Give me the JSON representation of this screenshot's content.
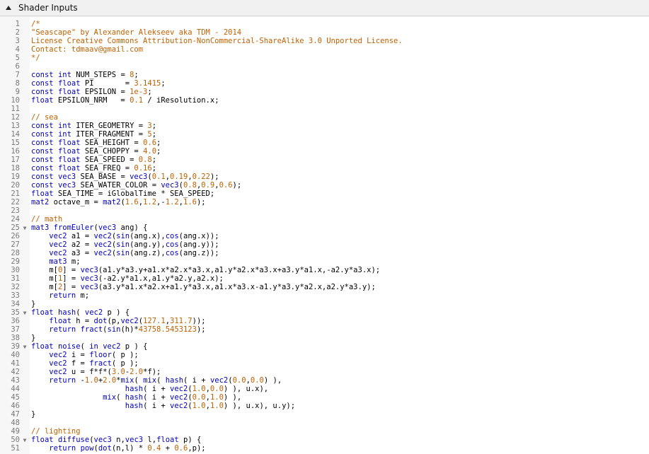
{
  "panel": {
    "title": "Shader Inputs",
    "collapse_icon": "triangle-up-icon"
  },
  "colors": {
    "comment": "#c06000",
    "keyword": "#0000c0",
    "number": "#c06000",
    "plain": "#000000",
    "gutter_text": "#7a7a7a"
  },
  "editor": {
    "lines": [
      {
        "n": "1",
        "fold": "",
        "text": "/*"
      },
      {
        "n": "2",
        "fold": "",
        "text": "\"Seascape\" by Alexander Alekseev aka TDM - 2014"
      },
      {
        "n": "3",
        "fold": "",
        "text": "License Creative Commons Attribution-NonCommercial-ShareAlike 3.0 Unported License."
      },
      {
        "n": "4",
        "fold": "",
        "text": "Contact: tdmaav@gmail.com"
      },
      {
        "n": "5",
        "fold": "",
        "text": "*/"
      },
      {
        "n": "6",
        "fold": "",
        "text": ""
      },
      {
        "n": "7",
        "fold": "",
        "text": "const int NUM_STEPS = 8;"
      },
      {
        "n": "8",
        "fold": "",
        "text": "const float PI       = 3.1415;"
      },
      {
        "n": "9",
        "fold": "",
        "text": "const float EPSILON = 1e-3;"
      },
      {
        "n": "10",
        "fold": "",
        "text": "float EPSILON_NRM   = 0.1 / iResolution.x;"
      },
      {
        "n": "11",
        "fold": "",
        "text": ""
      },
      {
        "n": "12",
        "fold": "",
        "text": "// sea"
      },
      {
        "n": "13",
        "fold": "",
        "text": "const int ITER_GEOMETRY = 3;"
      },
      {
        "n": "14",
        "fold": "",
        "text": "const int ITER_FRAGMENT = 5;"
      },
      {
        "n": "15",
        "fold": "",
        "text": "const float SEA_HEIGHT = 0.6;"
      },
      {
        "n": "16",
        "fold": "",
        "text": "const float SEA_CHOPPY = 4.0;"
      },
      {
        "n": "17",
        "fold": "",
        "text": "const float SEA_SPEED = 0.8;"
      },
      {
        "n": "18",
        "fold": "",
        "text": "const float SEA_FREQ = 0.16;"
      },
      {
        "n": "19",
        "fold": "",
        "text": "const vec3 SEA_BASE = vec3(0.1,0.19,0.22);"
      },
      {
        "n": "20",
        "fold": "",
        "text": "const vec3 SEA_WATER_COLOR = vec3(0.8,0.9,0.6);"
      },
      {
        "n": "21",
        "fold": "",
        "text": "float SEA_TIME = iGlobalTime * SEA_SPEED;"
      },
      {
        "n": "22",
        "fold": "",
        "text": "mat2 octave_m = mat2(1.6,1.2,-1.2,1.6);"
      },
      {
        "n": "23",
        "fold": "",
        "text": ""
      },
      {
        "n": "24",
        "fold": "",
        "text": "// math"
      },
      {
        "n": "25",
        "fold": "▼",
        "text": "mat3 fromEuler(vec3 ang) {"
      },
      {
        "n": "26",
        "fold": "",
        "text": "    vec2 a1 = vec2(sin(ang.x),cos(ang.x));"
      },
      {
        "n": "27",
        "fold": "",
        "text": "    vec2 a2 = vec2(sin(ang.y),cos(ang.y));"
      },
      {
        "n": "28",
        "fold": "",
        "text": "    vec2 a3 = vec2(sin(ang.z),cos(ang.z));"
      },
      {
        "n": "29",
        "fold": "",
        "text": "    mat3 m;"
      },
      {
        "n": "30",
        "fold": "",
        "text": "    m[0] = vec3(a1.y*a3.y+a1.x*a2.x*a3.x,a1.y*a2.x*a3.x+a3.y*a1.x,-a2.y*a3.x);"
      },
      {
        "n": "31",
        "fold": "",
        "text": "    m[1] = vec3(-a2.y*a1.x,a1.y*a2.y,a2.x);"
      },
      {
        "n": "32",
        "fold": "",
        "text": "    m[2] = vec3(a3.y*a1.x*a2.x+a1.y*a3.x,a1.x*a3.x-a1.y*a3.y*a2.x,a2.y*a3.y);"
      },
      {
        "n": "33",
        "fold": "",
        "text": "    return m;"
      },
      {
        "n": "34",
        "fold": "",
        "text": "}"
      },
      {
        "n": "35",
        "fold": "▼",
        "text": "float hash( vec2 p ) {"
      },
      {
        "n": "36",
        "fold": "",
        "text": "    float h = dot(p,vec2(127.1,311.7));"
      },
      {
        "n": "37",
        "fold": "",
        "text": "    return fract(sin(h)*43758.5453123);"
      },
      {
        "n": "38",
        "fold": "",
        "text": "}"
      },
      {
        "n": "39",
        "fold": "▼",
        "text": "float noise( in vec2 p ) {"
      },
      {
        "n": "40",
        "fold": "",
        "text": "    vec2 i = floor( p );"
      },
      {
        "n": "41",
        "fold": "",
        "text": "    vec2 f = fract( p );"
      },
      {
        "n": "42",
        "fold": "",
        "text": "    vec2 u = f*f*(3.0-2.0*f);"
      },
      {
        "n": "43",
        "fold": "",
        "text": "    return -1.0+2.0*mix( mix( hash( i + vec2(0.0,0.0) ),"
      },
      {
        "n": "44",
        "fold": "",
        "text": "                     hash( i + vec2(1.0,0.0) ), u.x),"
      },
      {
        "n": "45",
        "fold": "",
        "text": "                mix( hash( i + vec2(0.0,1.0) ),"
      },
      {
        "n": "46",
        "fold": "",
        "text": "                     hash( i + vec2(1.0,1.0) ), u.x), u.y);"
      },
      {
        "n": "47",
        "fold": "",
        "text": "}"
      },
      {
        "n": "48",
        "fold": "",
        "text": ""
      },
      {
        "n": "49",
        "fold": "",
        "text": "// lighting"
      },
      {
        "n": "50",
        "fold": "▼",
        "text": "float diffuse(vec3 n,vec3 l,float p) {"
      },
      {
        "n": "51",
        "fold": "",
        "text": "    return pow(dot(n,l) * 0.4 + 0.6,p);"
      }
    ]
  }
}
